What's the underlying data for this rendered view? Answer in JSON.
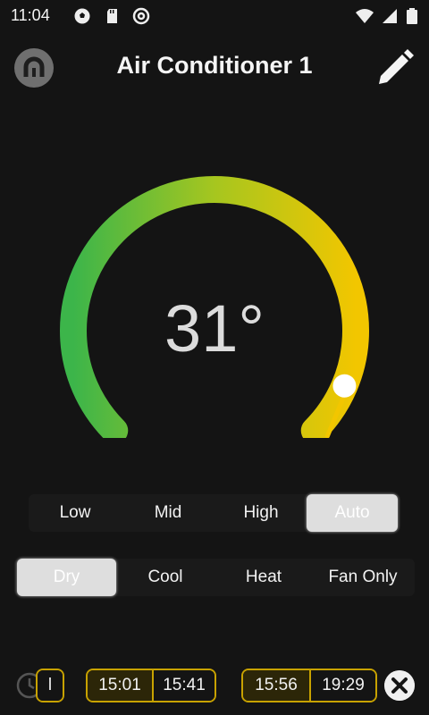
{
  "status_bar": {
    "time": "11:04",
    "left_icons": [
      "soccer-ball-icon",
      "sd-card-icon",
      "at-sign-icon"
    ],
    "right_icons": [
      "wifi-icon",
      "signal-icon",
      "battery-icon"
    ]
  },
  "header": {
    "title": "Air Conditioner 1",
    "left_icon": "power-logo-icon",
    "right_icon": "pencil-icon"
  },
  "dial": {
    "temperature": "31°",
    "level": 1.0,
    "gradient_colors": [
      "#3cb54a",
      "#a6c61f",
      "#f2c600"
    ]
  },
  "fan_speed": {
    "options": [
      "Low",
      "Mid",
      "High",
      "Auto"
    ],
    "selected_index": 3
  },
  "mode": {
    "options": [
      "Dry",
      "Cool",
      "Heat",
      "Fan Only"
    ],
    "selected_index": 0
  },
  "schedule": {
    "partial_label": "l",
    "groups": [
      {
        "on": "15:01",
        "off": "15:41"
      },
      {
        "on": "15:56",
        "off": "19:29"
      }
    ],
    "accent": "#c8a200"
  }
}
